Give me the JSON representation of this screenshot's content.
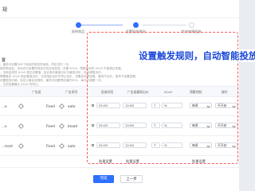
{
  "breadcrumb": "规",
  "steps": [
    "选择商品",
    "设置投放规则",
    "完成创建投放"
  ],
  "section": {
    "title": "置",
    "notes": [
      "，最多可设置300个商品的投放时间段，同步进行一次。",
      "新同商品后，自动对已设置的商品开启自动投放，设置 ACoS、限额自动时 ACoS 不能超过该值。",
      "，当商品投放 ACoS 超过设置值，结合竞价最高出价与最低出价，自动调整出价。",
      "需要最多 ACoS 指定最高出价，达到指定出价时停止加价，设置自动预设值，最低不加价，相关不设置金额。",
      "设置投放价格，自定义最优化规则，最多可设置预设值的50%，每次可调整一次。",
      "，达到设置最大 ACoS 时停止。"
    ]
  },
  "overlay_text": "设置触发规则，自动智能投放",
  "table": {
    "columns": [
      "广告组",
      "广告系列",
      "投放时段",
      "广告组最高出价",
      "ACoS",
      "预算控制",
      "操作"
    ],
    "rows": [
      {
        "name": "...o",
        "type": "Fixed",
        "status": "auto",
        "from": "02:00",
        "to": "12:00",
        "slot": "T",
        "acos": "%",
        "budget": "每周",
        "select": "不开启"
      },
      {
        "name": "...x",
        "type": "Fixed",
        "status": "broad",
        "from": "02:00",
        "to": "12:00",
        "slot": "T",
        "acos": "%",
        "budget": "每周",
        "select": "不开启"
      },
      {
        "name": "...mart",
        "type": "Fixed",
        "status": "auto",
        "from": "02:00",
        "to": "12:00",
        "slot": "T",
        "acos": "%",
        "budget": "每周",
        "select": "不开启"
      }
    ],
    "bulk": [
      "批量设置",
      "批量设置",
      "批量设置"
    ]
  },
  "footer": {
    "primary": "完成",
    "secondary": "上一步"
  }
}
